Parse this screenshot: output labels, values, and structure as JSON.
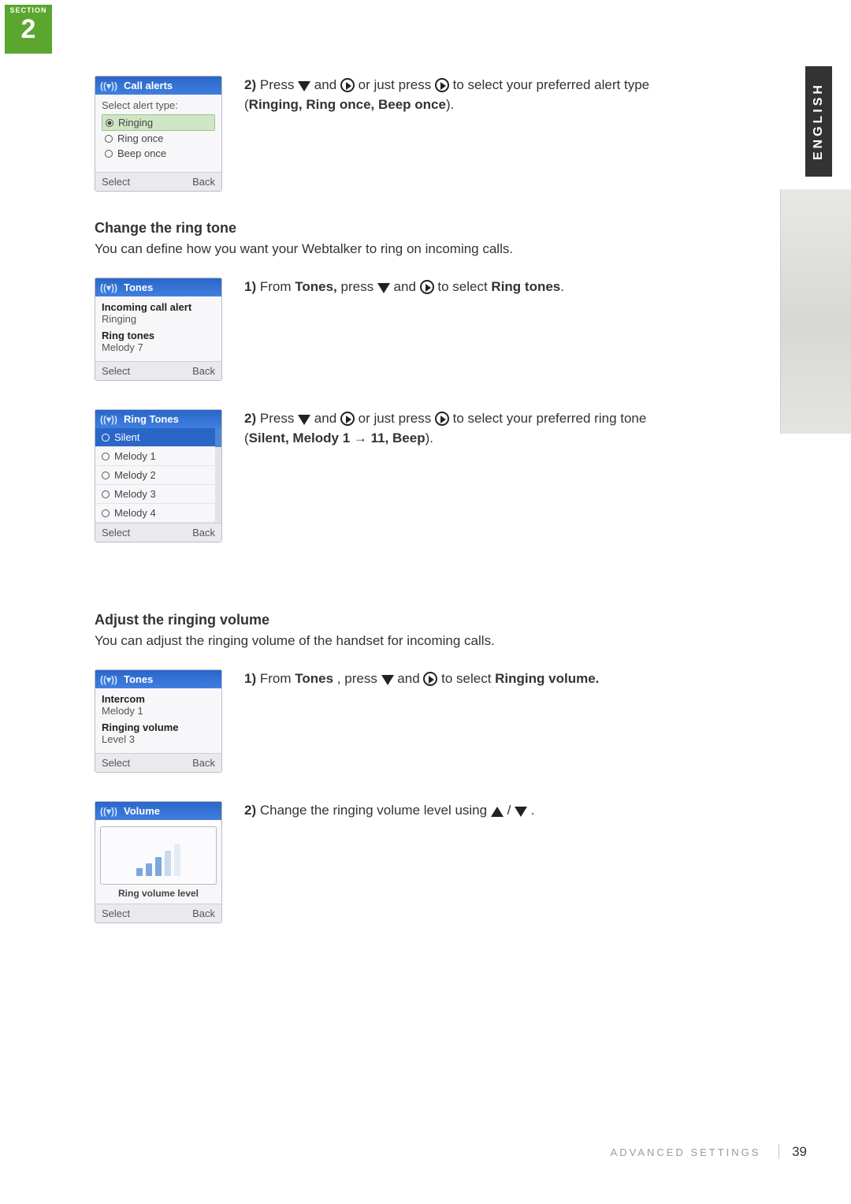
{
  "section_badge": {
    "label": "SECTION",
    "number": "2"
  },
  "side_tab": "ENGLISH",
  "footer": {
    "label": "ADVANCED SETTINGS",
    "page": "39"
  },
  "screen_call_alerts": {
    "title": "Call alerts",
    "prompt": "Select alert type:",
    "options": [
      "Ringing",
      "Ring once",
      "Beep once"
    ],
    "left": "Select",
    "right": "Back"
  },
  "step_call_alerts_2": {
    "num": "2)",
    "pre": "Press ",
    "mid1": " and ",
    "mid2": " or just press ",
    "post": " to select your preferred alert type (",
    "bold": "Ringing, Ring once, Beep once",
    "end": ")."
  },
  "heading_ring_tone": "Change the ring tone",
  "sub_ring_tone": "You can define how you want your Webtalker to ring on incoming calls.",
  "screen_tones_a": {
    "title": "Tones",
    "cat1": "Incoming call alert",
    "val1": "Ringing",
    "cat2": "Ring tones",
    "val2": "Melody 7",
    "left": "Select",
    "right": "Back"
  },
  "step_ring_1": {
    "num": "1)",
    "pre": "From ",
    "b1": "Tones,",
    "mid1": " press ",
    "mid2": " and ",
    "post": " to select ",
    "b2": "Ring tones",
    "end": "."
  },
  "screen_ring_tones": {
    "title": "Ring Tones",
    "options": [
      "Silent",
      "Melody 1",
      "Melody 2",
      "Melody 3",
      "Melody 4"
    ],
    "left": "Select",
    "right": "Back"
  },
  "step_ring_2": {
    "num": "2)",
    "pre": "Press ",
    "mid1": " and ",
    "mid2": " or just press ",
    "post": " to select your preferred ring tone (",
    "bold": "Silent, Melody 1 → 11, Beep",
    "end": ")."
  },
  "heading_volume": "Adjust the ringing volume",
  "sub_volume": "You can adjust the ringing volume of the handset for incoming calls.",
  "screen_tones_b": {
    "title": "Tones",
    "cat1": "Intercom",
    "val1": "Melody 1",
    "cat2": "Ringing volume",
    "val2": "Level 3",
    "left": "Select",
    "right": "Back"
  },
  "step_vol_1": {
    "num": "1)",
    "pre": "From ",
    "b1": "Tones",
    "mid1": ", press ",
    "mid2": " and ",
    "post": " to select ",
    "b2": "Ringing volume.",
    "end": ""
  },
  "screen_volume": {
    "title": "Volume",
    "caption": "Ring volume level",
    "left": "Select",
    "right": "Back"
  },
  "step_vol_2": {
    "num": "2)",
    "pre": "Change the ringing volume level using ",
    "mid": " / ",
    "end": " ."
  }
}
